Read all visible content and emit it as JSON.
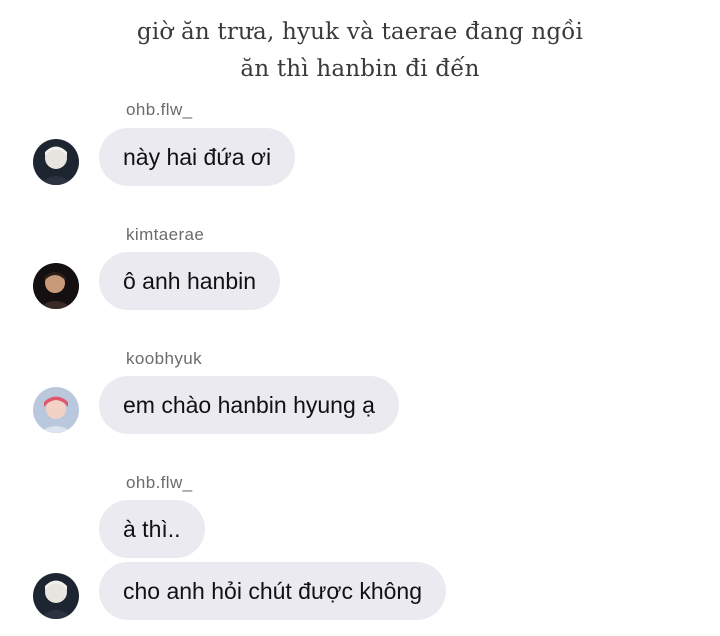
{
  "narration": {
    "line1": "giờ ăn trưa, hyuk và taerae đang ngồi",
    "line2": "ăn thì hanbin đi đến"
  },
  "messages": [
    {
      "username": "ohb.flw_",
      "bubbles": [
        "này hai đứa ơi"
      ],
      "avatar": "avatar-ohb"
    },
    {
      "username": "kimtaerae",
      "bubbles": [
        "ô anh hanbin"
      ],
      "avatar": "avatar-kimtaerae"
    },
    {
      "username": "koobhyuk",
      "bubbles": [
        "em chào hanbin hyung ạ"
      ],
      "avatar": "avatar-koobhyuk"
    },
    {
      "username": "ohb.flw_",
      "bubbles": [
        "à thì..",
        "cho anh hỏi chút được không"
      ],
      "avatar": "avatar-ohb"
    }
  ],
  "colors": {
    "bubble_bg": "#ebeaf0",
    "username_text": "#6b6b6b",
    "narration_text": "#3a3a3a"
  }
}
